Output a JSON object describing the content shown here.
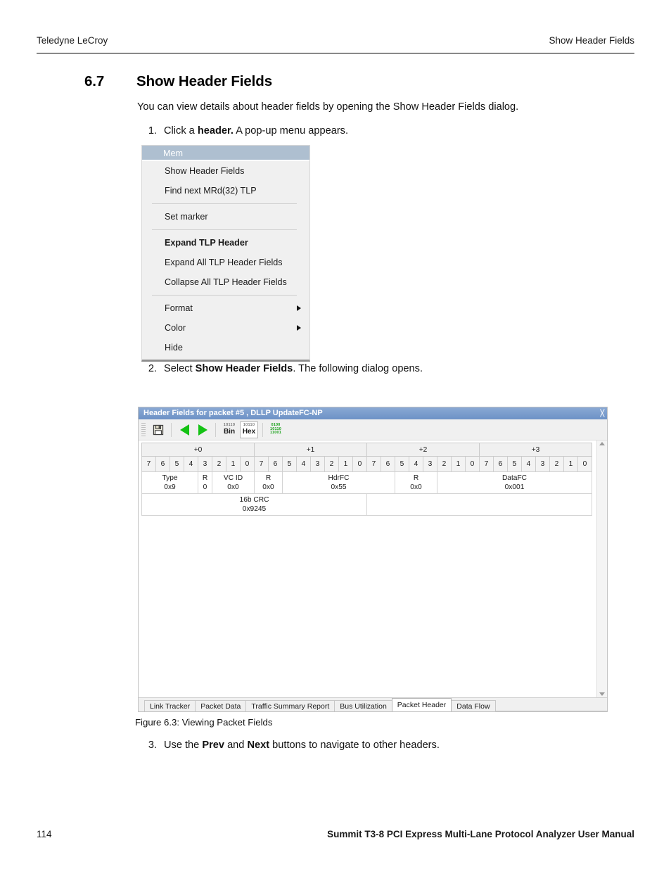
{
  "page": {
    "running_head_left": "Teledyne LeCroy",
    "running_head_right": "Show Header Fields",
    "section_number": "6.7",
    "section_title": "Show Header Fields",
    "intro": "You can view details about header fields by opening the Show Header Fields dialog.",
    "figure_caption": "Figure 6.3:  Viewing Packet Fields",
    "page_number": "114",
    "footer_title": "Summit T3-8 PCI Express Multi-Lane Protocol Analyzer User Manual"
  },
  "steps": [
    {
      "num": "1.",
      "pre": "Click a ",
      "bold": "header.",
      "post": " A pop-up menu appears."
    },
    {
      "num": "2.",
      "pre": "Select ",
      "bold": "Show Header Fields",
      "post": ". The following dialog opens."
    },
    {
      "num": "3.",
      "pre": "Use the ",
      "bold": "Prev",
      "mid": " and ",
      "bold2": "Next",
      "post": " buttons to navigate to other headers."
    }
  ],
  "popup_menu": {
    "title": "Mem",
    "title_bg": "#aebfd0",
    "items": [
      {
        "label": "Show Header Fields",
        "bold": false,
        "submenu": false
      },
      {
        "label": "Find next MRd(32) TLP",
        "bold": false,
        "submenu": false
      },
      {
        "separator": true
      },
      {
        "label": "Set marker",
        "bold": false,
        "submenu": false
      },
      {
        "separator": true
      },
      {
        "label": "Expand TLP Header",
        "bold": true,
        "submenu": false
      },
      {
        "label": "Expand All TLP Header Fields",
        "bold": false,
        "submenu": false
      },
      {
        "label": "Collapse All TLP Header Fields",
        "bold": false,
        "submenu": false
      },
      {
        "separator": true
      },
      {
        "label": "Format",
        "bold": false,
        "submenu": true
      },
      {
        "label": "Color",
        "bold": false,
        "submenu": true
      },
      {
        "label": "Hide",
        "bold": false,
        "submenu": false
      }
    ]
  },
  "dialog": {
    "title": "Header Fields for packet #5 , DLLP UpdateFC-NP",
    "title_bg": "#7a9dcd",
    "close_glyph": "╳",
    "toolbar": {
      "save_tooltip": "Save",
      "prev_tooltip": "Prev",
      "next_tooltip": "Next",
      "bin_label": "Bin",
      "hex_label": "Hex",
      "bin_dots": "10110",
      "hex_active": true,
      "binary_view_rows": [
        "0100",
        "10110",
        "11001"
      ]
    },
    "grid": {
      "byte_headers": [
        "+0",
        "+1",
        "+2",
        "+3"
      ],
      "bit_labels": [
        "7",
        "6",
        "5",
        "4",
        "3",
        "2",
        "1",
        "0"
      ],
      "rows": [
        {
          "fields": [
            {
              "name": "Type",
              "value": "0x9",
              "span": 4
            },
            {
              "name": "R",
              "value": "0",
              "span": 1
            },
            {
              "name": "VC ID",
              "value": "0x0",
              "span": 3
            },
            {
              "name": "R",
              "value": "0x0",
              "span": 2
            },
            {
              "name": "HdrFC",
              "value": "0x55",
              "span": 8
            },
            {
              "name": "R",
              "value": "0x0",
              "span": 3
            },
            {
              "name": "DataFC",
              "value": "0x001",
              "span": 11
            }
          ]
        },
        {
          "fields": [
            {
              "name": "16b CRC",
              "value": "0x9245",
              "span": 16
            },
            {
              "name": "",
              "value": "",
              "span": 16,
              "empty": true
            }
          ]
        }
      ]
    },
    "tabs": [
      {
        "label": "Link Tracker",
        "active": false
      },
      {
        "label": "Packet Data",
        "active": false
      },
      {
        "label": "Traffic Summary Report",
        "active": false
      },
      {
        "label": "Bus Utilization",
        "active": false
      },
      {
        "label": "Packet Header",
        "active": true
      },
      {
        "label": "Data Flow",
        "active": false
      }
    ],
    "scrollbar": {
      "up_icon": "scroll-up-arrow-icon",
      "down_icon": "scroll-down-arrow-icon"
    }
  }
}
